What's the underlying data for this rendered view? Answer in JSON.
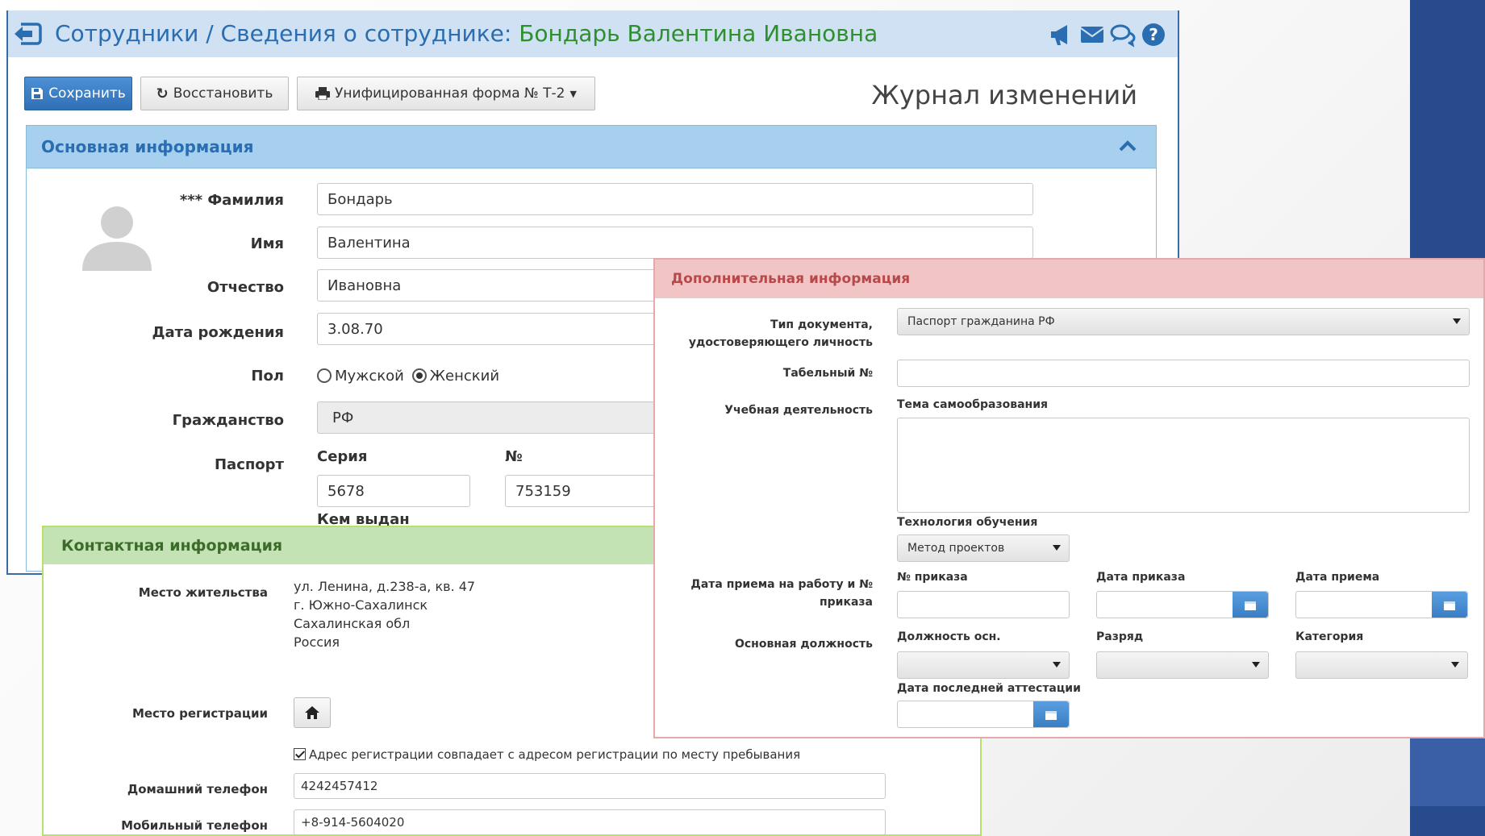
{
  "header": {
    "breadcrumb": "Сотрудники / Сведения о сотруднике: ",
    "employee_name": "Бондарь Валентина Ивановна",
    "icons": [
      "bullhorn-icon",
      "envelope-icon",
      "comments-icon",
      "question-circle-icon"
    ]
  },
  "toolbar": {
    "save_label": "Сохранить",
    "restore_label": "Восстановить",
    "form_label": "Унифицированная форма № Т-2",
    "journal_label": "Журнал изменений"
  },
  "main_section": {
    "title": "Основная информация",
    "surname_label": "*** Фамилия",
    "surname_value": "Бондарь",
    "name_label": "Имя",
    "name_value": "Валентина",
    "patronymic_label": "Отчество",
    "patronymic_value": "Ивановна",
    "birthdate_label": "Дата рождения",
    "birthdate_value": "3.08.70",
    "gender_label": "Пол",
    "gender_male": "Мужской",
    "gender_female": "Женский",
    "gender_selected": "Женский",
    "citizenship_label": "Гражданство",
    "citizenship_value": "РФ",
    "passport_label": "Паспорт",
    "series_label": "Серия",
    "series_value": "5678",
    "number_label": "№",
    "number_value": "753159",
    "issued_by_label": "Кем выдан"
  },
  "contact_section": {
    "title": "Контактная информация",
    "residence_label": "Место жительства",
    "residence_lines": [
      "ул. Ленина, д.238-а, кв. 47",
      "г. Южно-Сахалинск",
      "Сахалинская обл",
      "Россия"
    ],
    "registration_label": "Место регистрации",
    "same_address_label": "Адрес регистрации совпадает с адресом регистрации по месту пребывания",
    "home_phone_label": "Домашний телефон",
    "home_phone_value": "4242457412",
    "mobile_phone_label": "Мобильный телефон",
    "mobile_phone_value": "+8-914-5604020"
  },
  "additional_section": {
    "title": "Дополнительная информация",
    "doc_type_label_1": "Тип документа,",
    "doc_type_label_2": "удостоверяющего личность",
    "doc_type_value": "Паспорт гражданина РФ",
    "tab_number_label": "Табельный №",
    "tab_number_value": "",
    "education_label": "Учебная деятельность",
    "self_education_label": "Тема самообразования",
    "self_education_value": "",
    "tech_label": "Технология обучения",
    "tech_value": "Метод проектов",
    "hire_label_1": "Дата приема на работу и №",
    "hire_label_2": "приказа",
    "order_number_label": "№ приказа",
    "order_date_label": "Дата приказа",
    "hire_date_label": "Дата приема",
    "main_position_label": "Основная должность",
    "position_label": "Должность осн.",
    "grade_label": "Разряд",
    "category_label": "Категория",
    "last_attestation_label": "Дата последней аттестации"
  }
}
